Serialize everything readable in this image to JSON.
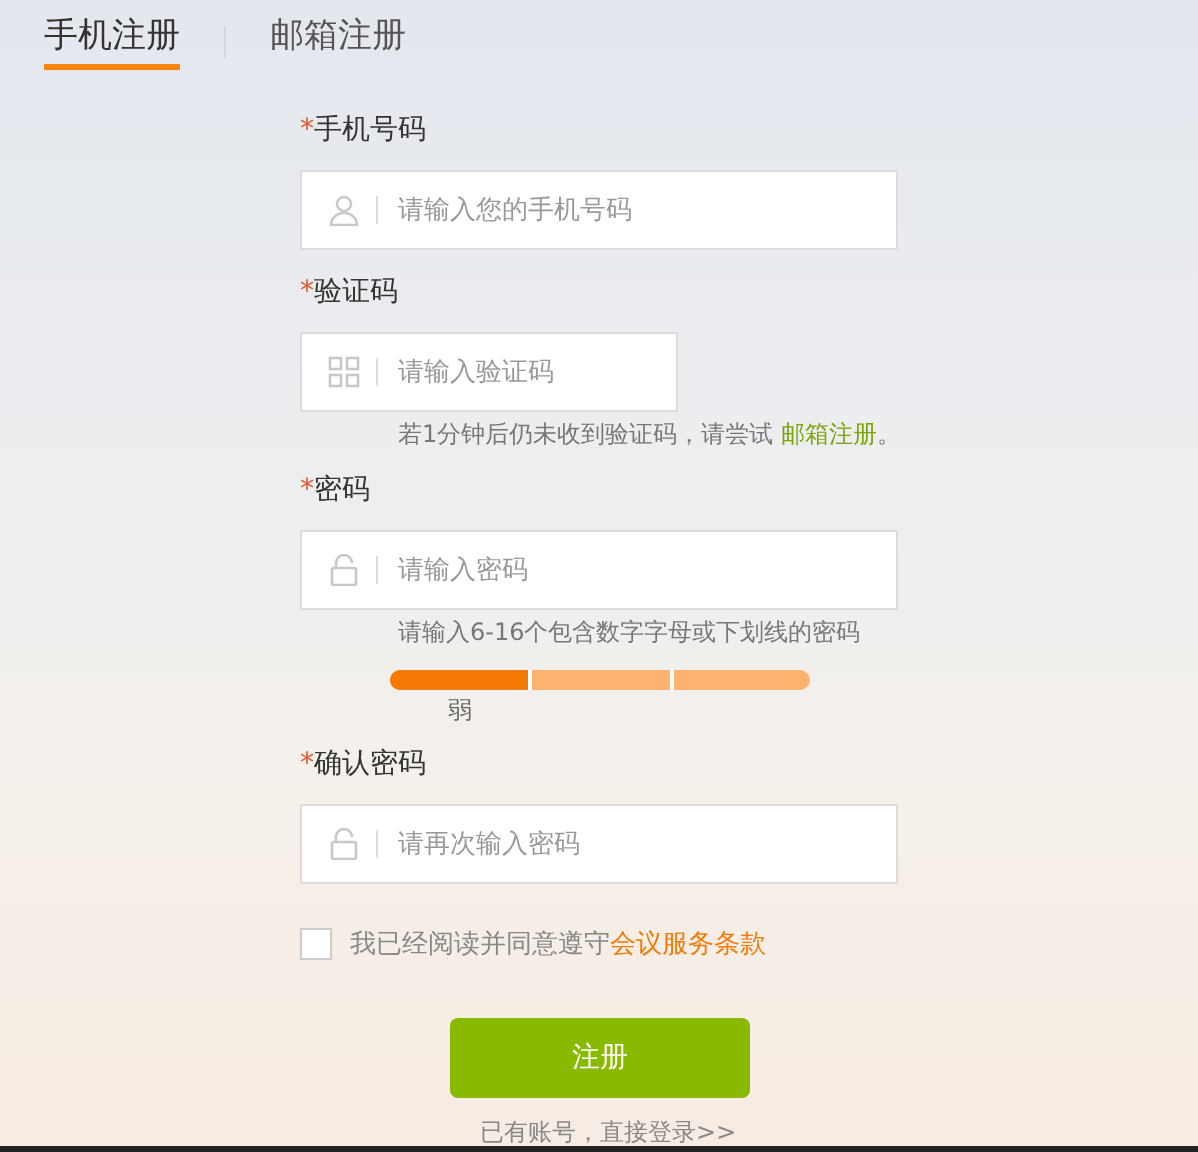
{
  "tabs": [
    {
      "label": "手机注册",
      "selected": true
    },
    {
      "label": "邮箱注册",
      "selected": false
    }
  ],
  "fields": [
    {
      "label": "手机号码",
      "required": "*",
      "kind": "phone",
      "placeholder": "请输入您的手机号码"
    },
    {
      "label": "验证码",
      "required": "*",
      "kind": "code",
      "placeholder": "请输入验证码",
      "hint": {
        "text": "若1分钟后仍未收到验证码，请尝试 ",
        "link": "邮箱注册",
        "after": "。"
      }
    },
    {
      "label": "密码",
      "required": "*",
      "kind": "password",
      "placeholder": "请输入密码",
      "hint": {
        "text": "请输入6-16个包含数字字母或下划线的密码"
      },
      "strength": {
        "level": 0.33,
        "label": "弱"
      }
    },
    {
      "label": "确认密码",
      "required": "*",
      "kind": "password",
      "placeholder": "请再次输入密码"
    }
  ],
  "agreement": {
    "checked": false,
    "text": "我已经阅读并同意遵守",
    "link": "会议服务条款"
  },
  "submit": "注册",
  "login_link": "已有账号，直接登录>>"
}
